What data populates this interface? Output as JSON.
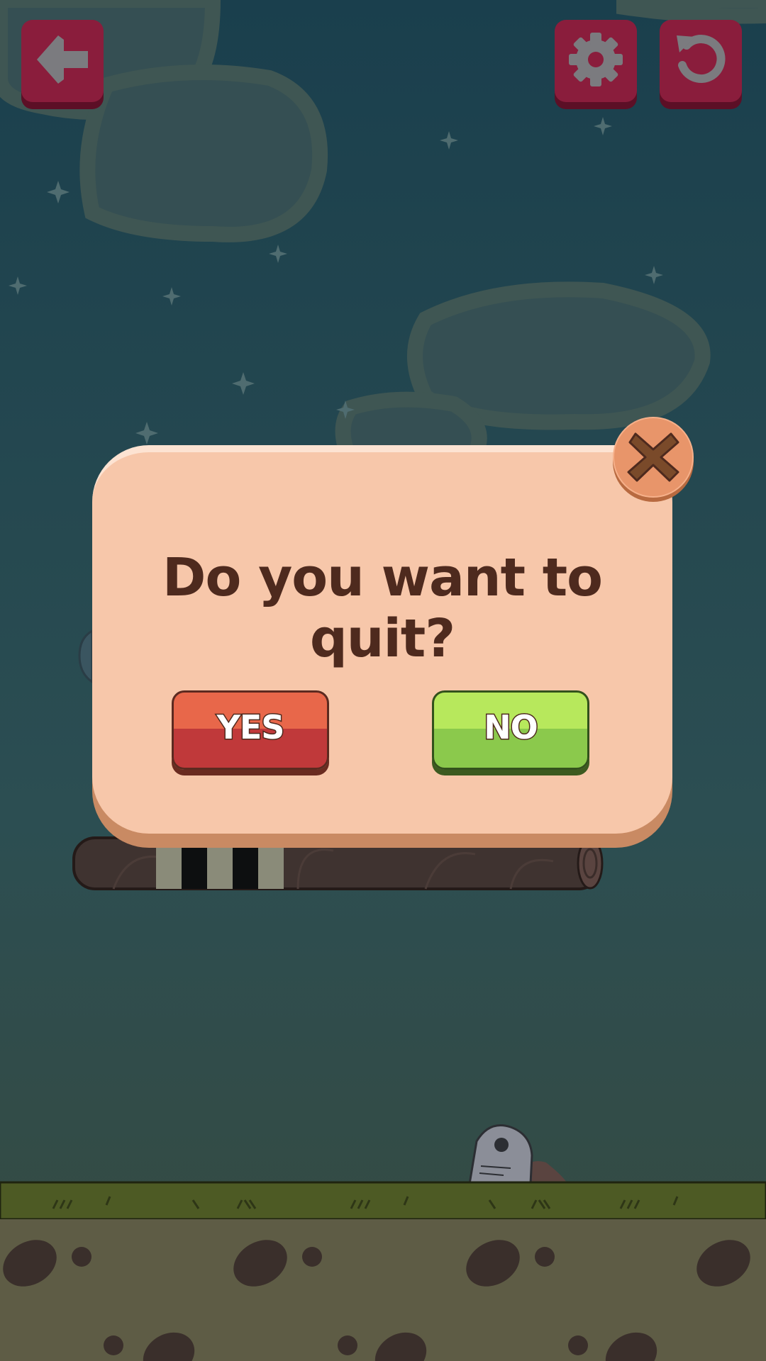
{
  "screen": "quit-confirm",
  "dialog": {
    "title": "Do you want to quit?",
    "yes_label": "YES",
    "no_label": "NO",
    "close_icon": "close-icon"
  },
  "top_bar": {
    "back_icon": "back-arrow-icon",
    "settings_icon": "gear-icon",
    "restart_icon": "restart-icon"
  },
  "colors": {
    "sky": "#1d4450",
    "button_maroon": "#8a1d3c",
    "dialog_bg": "#f7c7aa",
    "title_text": "#4e2a1e",
    "yes_button": "#c0393a",
    "no_button": "#8bc94c",
    "close_button": "#e8956a",
    "grass": "#4d5a24",
    "dirt": "#5c5c42"
  }
}
